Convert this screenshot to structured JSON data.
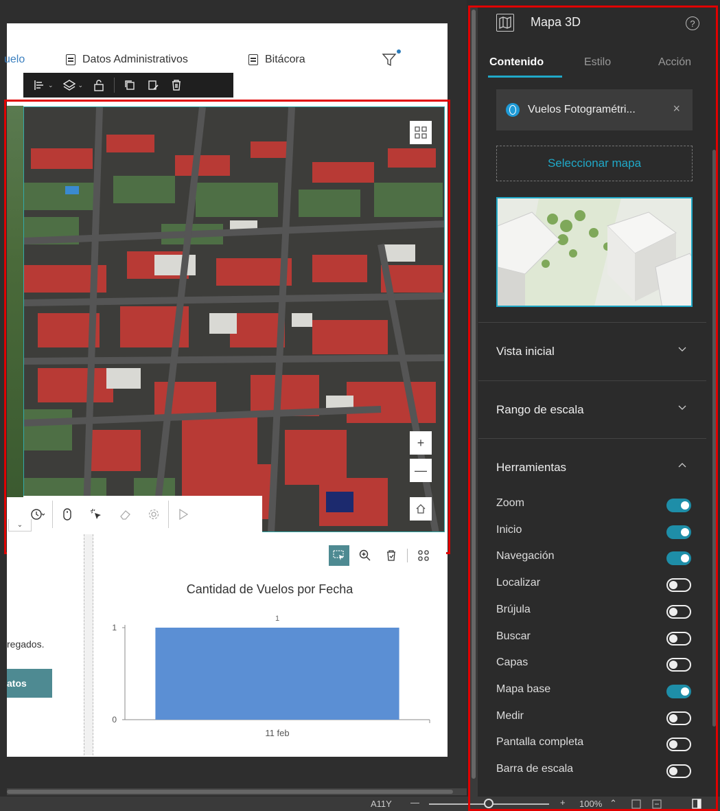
{
  "nav": {
    "items": [
      {
        "label": "uelo",
        "icon": "document-icon"
      },
      {
        "label": "Datos Administrativos",
        "icon": "document-icon"
      },
      {
        "label": "Bitácora",
        "icon": "document-icon"
      }
    ],
    "filter_icon": "filter-icon"
  },
  "toolbar": {
    "icons": [
      "align-icon",
      "layers-icon",
      "unlock-icon",
      "copy-icon",
      "edit-icon",
      "delete-icon"
    ]
  },
  "map": {
    "controls": {
      "zoom_in": "+",
      "zoom_out": "—"
    },
    "toolbar_icons": [
      "history-icon",
      "mouse-icon",
      "select-icon",
      "eraser-icon",
      "settings-icon",
      "play-icon"
    ]
  },
  "left_card": {
    "text": "regados.",
    "button_label": "atos"
  },
  "chart_card": {
    "tools": [
      "selection-icon",
      "zoom-icon",
      "clear-selection-icon",
      "grid-icon"
    ]
  },
  "chart_data": {
    "type": "bar",
    "title": "Cantidad de Vuelos por Fecha",
    "categories": [
      "11 feb"
    ],
    "values": [
      1
    ],
    "data_labels": [
      "1"
    ],
    "ytick_labels": [
      "1",
      "0"
    ],
    "ylim": [
      0,
      1
    ],
    "bar_color": "#5b8fd4"
  },
  "status_bar": {
    "a11y": "A11Y",
    "zoom_minus": "—",
    "zoom_plus": "+",
    "zoom_level": "100%",
    "zoom_percent": 100
  },
  "panel": {
    "title": "Mapa 3D",
    "help": "?",
    "tabs": [
      {
        "label": "Contenido",
        "active": true
      },
      {
        "label": "Estilo",
        "active": false
      },
      {
        "label": "Acción",
        "active": false
      }
    ],
    "source_chip": {
      "label": "Vuelos Fotogramétri...",
      "close": "×"
    },
    "select_map_label": "Seleccionar mapa",
    "sections": [
      {
        "label": "Vista inicial",
        "expanded": false
      },
      {
        "label": "Rango de escala",
        "expanded": false
      },
      {
        "label": "Herramientas",
        "expanded": true
      }
    ],
    "tools": [
      {
        "label": "Zoom",
        "on": true
      },
      {
        "label": "Inicio",
        "on": true
      },
      {
        "label": "Navegación",
        "on": true
      },
      {
        "label": "Localizar",
        "on": false
      },
      {
        "label": "Brújula",
        "on": false
      },
      {
        "label": "Buscar",
        "on": false
      },
      {
        "label": "Capas",
        "on": false
      },
      {
        "label": "Mapa base",
        "on": true
      },
      {
        "label": "Medir",
        "on": false
      },
      {
        "label": "Pantalla completa",
        "on": false
      },
      {
        "label": "Barra de escala",
        "on": false
      }
    ]
  },
  "colors": {
    "accent": "#20a9c8",
    "toggle_on": "#1e8ea8",
    "highlight": "#e00000",
    "button_teal": "#4e8a92"
  }
}
